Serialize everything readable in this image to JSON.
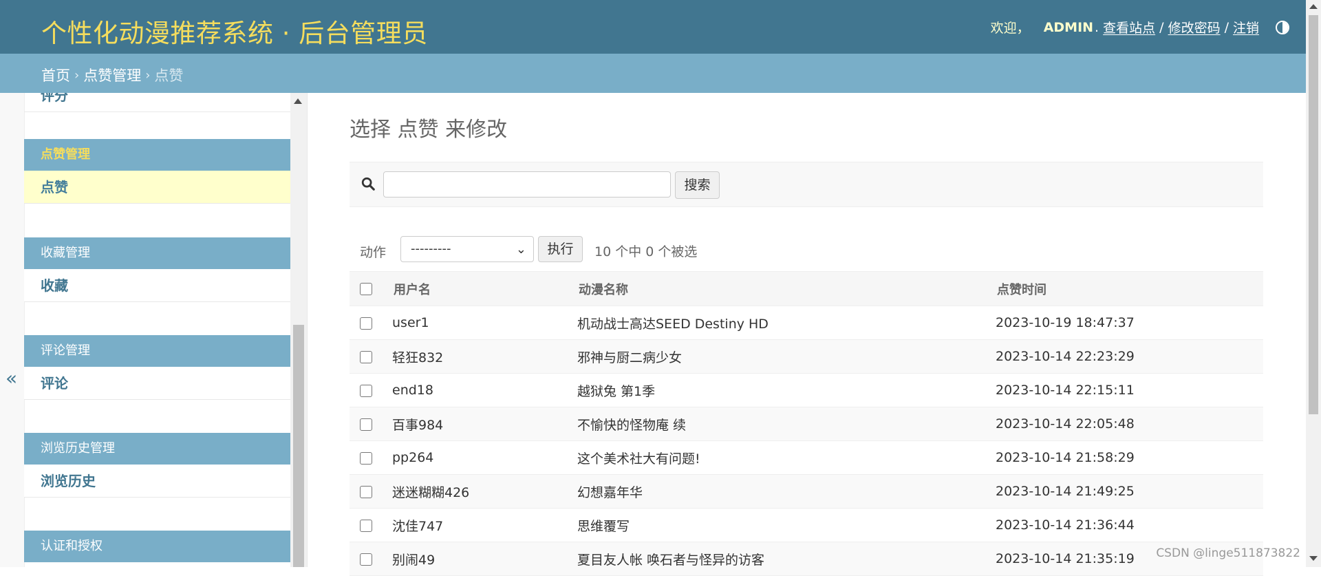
{
  "header": {
    "brand": "个性化动漫推荐系统 · 后台管理员",
    "welcome": "欢迎，",
    "username": "ADMIN",
    "view_site": "查看站点",
    "change_password": "修改密码",
    "logout": "注销",
    "sep": "/"
  },
  "breadcrumbs": {
    "home": "首页",
    "app": "点赞管理",
    "current": "点赞",
    "sep": "›"
  },
  "sidebar": {
    "collapse_label": "«",
    "cut_item": "评分",
    "modules": [
      {
        "caption": "点赞管理",
        "item": "点赞"
      },
      {
        "caption": "收藏管理",
        "item": "收藏"
      },
      {
        "caption": "评论管理",
        "item": "评论"
      },
      {
        "caption": "浏览历史管理",
        "item": "浏览历史"
      },
      {
        "caption": "认证和授权"
      }
    ]
  },
  "main": {
    "title": "选择 点赞 来修改",
    "search_button": "搜索",
    "search_value": "",
    "action_label": "动作",
    "action_selected": "---------",
    "go_button": "执行",
    "counter": "10 个中 0 个被选",
    "columns": [
      "用户名",
      "动漫名称",
      "点赞时间"
    ],
    "rows": [
      {
        "user": "user1",
        "anime": "机动战士高达SEED Destiny HD",
        "time": "2023-10-19 18:47:37"
      },
      {
        "user": "轻狂832",
        "anime": "邪神与厨二病少女",
        "time": "2023-10-14 22:23:29"
      },
      {
        "user": "end18",
        "anime": "越狱兔 第1季",
        "time": "2023-10-14 22:15:11"
      },
      {
        "user": "百事984",
        "anime": "不愉快的怪物庵 续",
        "time": "2023-10-14 22:05:48"
      },
      {
        "user": "pp264",
        "anime": "这个美术社大有问题!",
        "time": "2023-10-14 21:58:29"
      },
      {
        "user": "迷迷糊糊426",
        "anime": "幻想嘉年华",
        "time": "2023-10-14 21:49:25"
      },
      {
        "user": "沈佳747",
        "anime": "思维覆写",
        "time": "2023-10-14 21:36:44"
      },
      {
        "user": "别闹49",
        "anime": "夏目友人帐 唤石者与怪异的访客",
        "time": "2023-10-14 21:35:19"
      }
    ]
  },
  "watermark": "CSDN @linge511873822",
  "colors": {
    "header_bg": "#417690",
    "breadcrumb_bg": "#79aec8",
    "brand_text": "#f5dd5d",
    "selected_row_bg": "#ffffcc",
    "link": "#417690"
  }
}
